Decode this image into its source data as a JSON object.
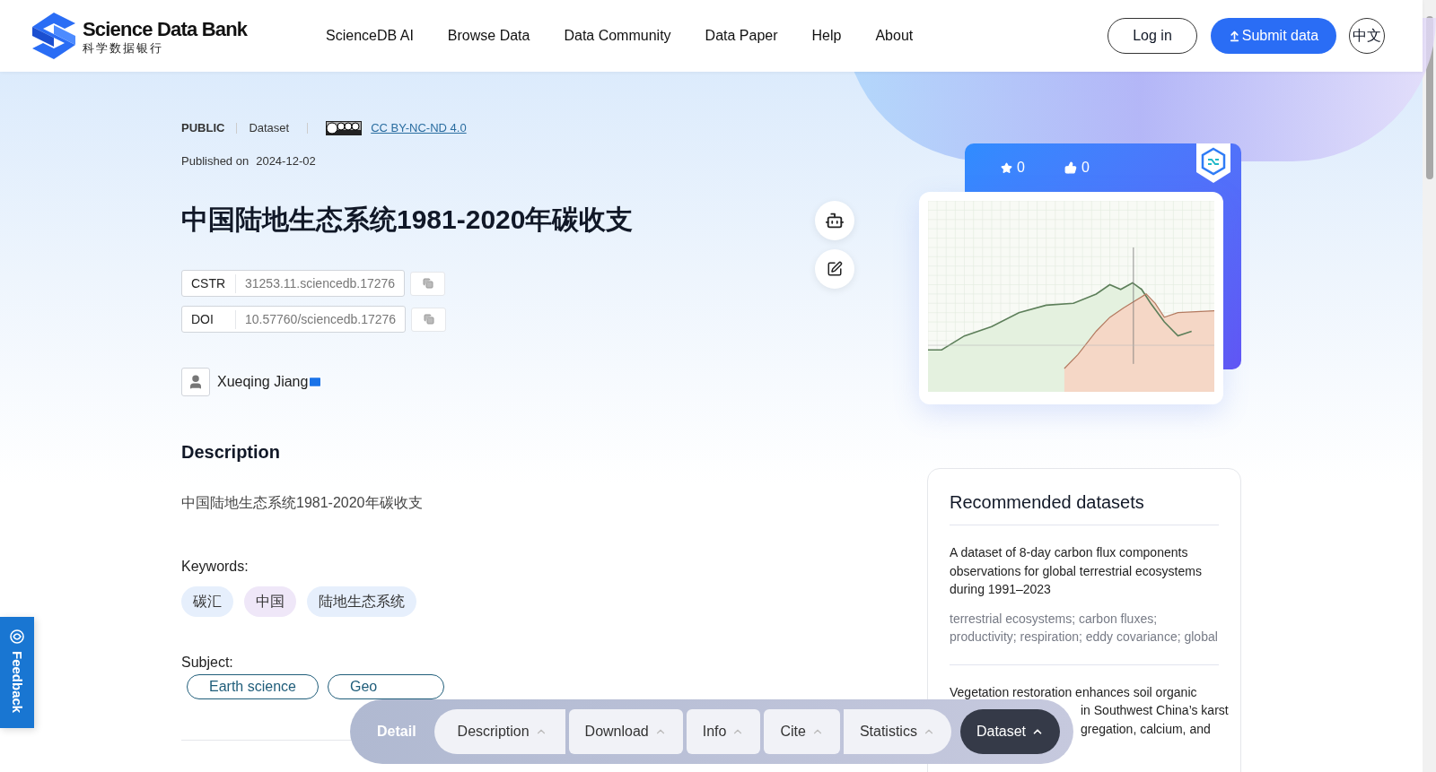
{
  "header": {
    "logo": {
      "title": "Science Data Bank",
      "subtitle": "科学数据银行"
    },
    "nav": [
      "ScienceDB AI",
      "Browse Data",
      "Data Community",
      "Data Paper",
      "Help",
      "About"
    ],
    "login": "Log in",
    "submit": "Submit data",
    "language": "中文"
  },
  "meta": {
    "access": "PUBLIC",
    "type": "Dataset",
    "license": "CC BY-NC-ND 4.0",
    "published_label": "Published on",
    "published_date": "2024-12-02"
  },
  "title": "中国陆地生态系统1981-2020年碳收支",
  "identifiers": [
    {
      "label": "CSTR",
      "value": "31253.11.sciencedb.17276"
    },
    {
      "label": "DOI",
      "value": "10.57760/sciencedb.17276"
    }
  ],
  "author": "Xueqing Jiang",
  "description": {
    "heading": "Description",
    "text": "中国陆地生态系统1981-2020年碳收支"
  },
  "keywords": {
    "label": "Keywords:",
    "items": [
      {
        "text": "碳汇",
        "color": "#e6effc"
      },
      {
        "text": "中国",
        "color": "#efe7f8"
      },
      {
        "text": "陆地生态系统",
        "color": "#e6effc"
      }
    ]
  },
  "subject": {
    "label": "Subject:",
    "items": [
      "Earth science",
      "Geo"
    ]
  },
  "stats": {
    "stars": "0",
    "likes": "0"
  },
  "recommended": {
    "title": "Recommended datasets",
    "items": [
      {
        "title_lines": [
          "A dataset of 8-day carbon flux components observations for global terrestrial ecosystems during 1991–2023"
        ],
        "keywords": "terrestrial ecosystems; carbon fluxes; productivity; respiration; eddy covariance; global"
      },
      {
        "title_lines": [
          "Vegetation restoration enhances soil organic",
          "in Southwest China’s karst",
          "gregation, calcium, and"
        ]
      }
    ]
  },
  "feedback": "Feedback",
  "bottom_nav": {
    "title": "Detail",
    "tabs": [
      {
        "label": "Description",
        "selected": false
      },
      {
        "label": "Download",
        "selected": false
      },
      {
        "label": "Info",
        "selected": false
      },
      {
        "label": "Cite",
        "selected": false
      },
      {
        "label": "Statistics",
        "selected": false
      },
      {
        "label": "Dataset",
        "selected": true
      }
    ]
  }
}
